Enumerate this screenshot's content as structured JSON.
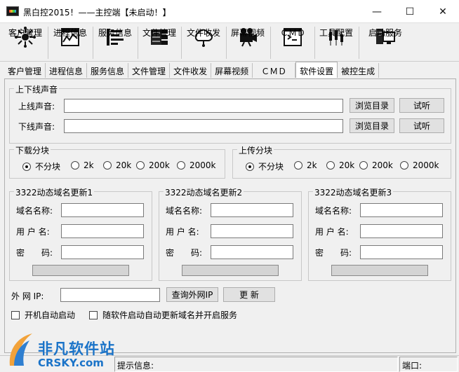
{
  "window": {
    "title": "黑白控2015！——主控端【未启动！】",
    "minimize": "—",
    "maximize": "☐",
    "close": "✕"
  },
  "toolbar": [
    {
      "label": "客户管理",
      "icon": "client-manage-icon"
    },
    {
      "label": "进程信息",
      "icon": "process-info-icon"
    },
    {
      "label": "服务信息",
      "icon": "service-info-icon"
    },
    {
      "label": "文件管理",
      "icon": "file-manage-icon"
    },
    {
      "label": "文件收发",
      "icon": "file-transfer-icon"
    },
    {
      "label": "屏幕视频",
      "icon": "screen-video-icon"
    },
    {
      "label": "ＣＭＤ",
      "icon": "cmd-icon"
    },
    {
      "label": "工具配置",
      "icon": "tool-config-icon"
    },
    {
      "label": "启动服务",
      "icon": "start-service-icon"
    }
  ],
  "tabs": [
    "客户管理",
    "进程信息",
    "服务信息",
    "文件管理",
    "文件收发",
    "屏幕视频",
    "ＣＭＤ",
    "软件设置",
    "被控生成"
  ],
  "active_tab": "软件设置",
  "sound": {
    "group_title": "上下线声音",
    "online_label": "上线声音:",
    "offline_label": "下线声音:",
    "online_value": "",
    "offline_value": "",
    "browse": "浏览目录",
    "test": "试听"
  },
  "download_chunk": {
    "title": "下载分块",
    "options": [
      "不分块",
      "2k",
      "20k",
      "200k",
      "2000k"
    ],
    "selected": "不分块"
  },
  "upload_chunk": {
    "title": "上传分块",
    "options": [
      "不分块",
      "2k",
      "20k",
      "200k",
      "2000k"
    ],
    "selected": "不分块"
  },
  "ddns": [
    {
      "title": "3322动态域名更新1",
      "domain_label": "域名名称:",
      "user_label": "用 户 名:",
      "pass_label": "密　　码:",
      "domain": "",
      "user": "",
      "pass": ""
    },
    {
      "title": "3322动态域名更新2",
      "domain_label": "域名名称:",
      "user_label": "用 户 名:",
      "pass_label": "密　　码:",
      "domain": "",
      "user": "",
      "pass": ""
    },
    {
      "title": "3322动态域名更新3",
      "domain_label": "域名名称:",
      "user_label": "用 户 名:",
      "pass_label": "密　　码:",
      "domain": "",
      "user": "",
      "pass": ""
    }
  ],
  "external_ip": {
    "label": "外 网 IP:",
    "value": "",
    "query_button": "查询外网IP",
    "refresh_button": "更 新"
  },
  "checkboxes": {
    "autostart": "开机自动启动",
    "auto_update": "随软件启动自动更新域名并开启服务"
  },
  "status": {
    "hint_label": "提示信息:",
    "port_label": "端口:"
  },
  "watermark": {
    "line1": "非凡软件站",
    "line2": "CRSKY.com"
  }
}
